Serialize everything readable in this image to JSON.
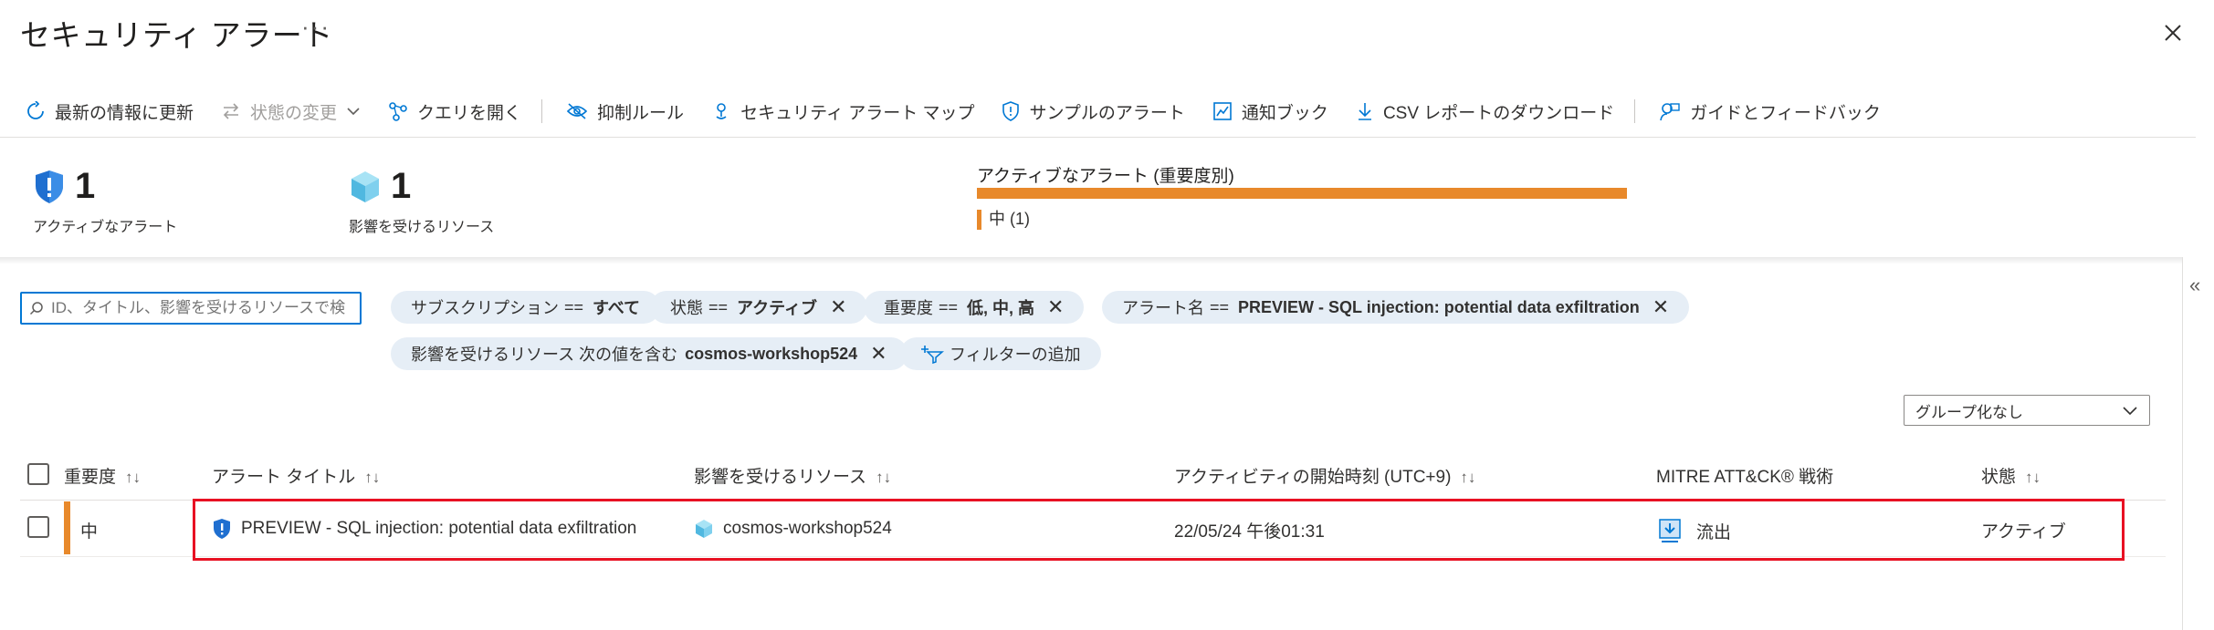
{
  "header": {
    "title": "セキュリティ アラート",
    "more": "···"
  },
  "toolbar": [
    {
      "label": "最新の情報に更新",
      "icon": "refresh-icon",
      "disabled": false
    },
    {
      "label": "状態の変更",
      "icon": "swap-icon",
      "disabled": true
    },
    {
      "label": "クエリを開く",
      "icon": "query-icon",
      "disabled": false
    },
    {
      "label": "抑制ルール",
      "icon": "eye-slash-icon",
      "disabled": false
    },
    {
      "label": "セキュリティ アラート マップ",
      "icon": "map-pin-icon",
      "disabled": false
    },
    {
      "label": "サンプルのアラート",
      "icon": "shield-icon",
      "disabled": false
    },
    {
      "label": "通知ブック",
      "icon": "chart-icon",
      "disabled": false
    },
    {
      "label": "CSV レポートのダウンロード",
      "icon": "download-icon",
      "disabled": false
    },
    {
      "label": "ガイドとフィードバック",
      "icon": "feedback-icon",
      "disabled": false
    }
  ],
  "summary": {
    "active_alerts": {
      "value": "1",
      "label": "アクティブなアラート"
    },
    "affected_resources": {
      "value": "1",
      "label": "影響を受けるリソース"
    },
    "severity_chart": {
      "title": "アクティブなアラート (重要度別)",
      "legend": "中 (1)",
      "color": "#e8892b"
    }
  },
  "search": {
    "placeholder": "ID、タイトル、影響を受けるリソースで検"
  },
  "filters": {
    "subscription": {
      "label": "サブスクリプション",
      "op": "==",
      "value": "すべて"
    },
    "status": {
      "label": "状態",
      "op": "==",
      "value": "アクティブ"
    },
    "severity": {
      "label": "重要度",
      "op": "==",
      "value": "低, 中, 高"
    },
    "alert_name": {
      "label": "アラート名",
      "op": "==",
      "value": "PREVIEW - SQL injection: potential data exfiltration"
    },
    "resource": {
      "label": "影響を受けるリソース 次の値を含む",
      "value": "cosmos-workshop524"
    },
    "add_filter": "フィルターの追加"
  },
  "group_by": {
    "selected": "グループ化なし"
  },
  "table": {
    "columns": {
      "severity": "重要度",
      "title": "アラート タイトル",
      "resource": "影響を受けるリソース",
      "start_time": "アクティビティの開始時刻 (UTC+9)",
      "tactics": "MITRE ATT&CK® 戦術",
      "status": "状態"
    },
    "rows": [
      {
        "severity": "中",
        "title": "PREVIEW - SQL injection: potential data exfiltration",
        "resource": "cosmos-workshop524",
        "start_time": "22/05/24 午後01:31",
        "tactic": "流出",
        "status": "アクティブ"
      }
    ]
  },
  "colors": {
    "accent": "#0078d4",
    "severity_medium": "#e8892b",
    "highlight": "#e81123"
  }
}
